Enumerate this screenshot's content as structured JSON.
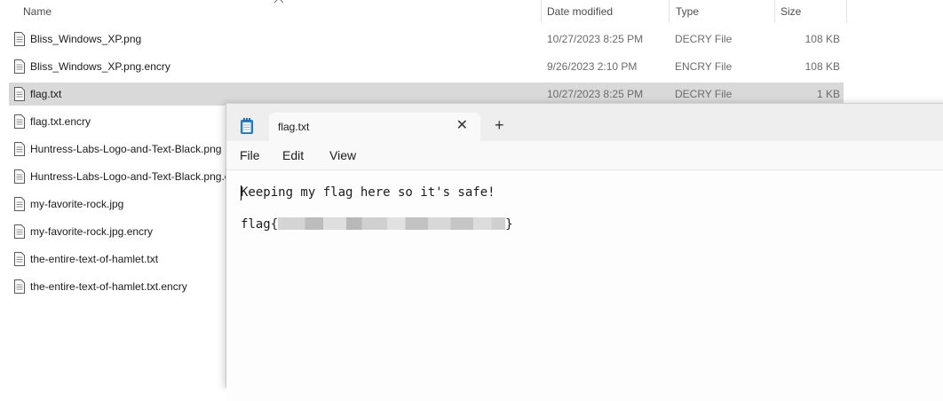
{
  "explorer": {
    "columns": {
      "name": "Name",
      "date": "Date modified",
      "type": "Type",
      "size": "Size"
    },
    "files": [
      {
        "name": "Bliss_Windows_XP.png",
        "date": "10/27/2023 8:25 PM",
        "type": "DECRY File",
        "size": "108 KB",
        "selected": false
      },
      {
        "name": "Bliss_Windows_XP.png.encry",
        "date": "9/26/2023 2:10 PM",
        "type": "ENCRY File",
        "size": "108 KB",
        "selected": false
      },
      {
        "name": "flag.txt",
        "date": "10/27/2023 8:25 PM",
        "type": "DECRY File",
        "size": "1 KB",
        "selected": true
      },
      {
        "name": "flag.txt.encry",
        "date": "",
        "type": "",
        "size": "",
        "selected": false
      },
      {
        "name": "Huntress-Labs-Logo-and-Text-Black.png",
        "date": "",
        "type": "",
        "size": "",
        "selected": false
      },
      {
        "name": "Huntress-Labs-Logo-and-Text-Black.png.e",
        "date": "",
        "type": "",
        "size": "",
        "selected": false
      },
      {
        "name": "my-favorite-rock.jpg",
        "date": "",
        "type": "",
        "size": "",
        "selected": false
      },
      {
        "name": "my-favorite-rock.jpg.encry",
        "date": "",
        "type": "",
        "size": "",
        "selected": false
      },
      {
        "name": "the-entire-text-of-hamlet.txt",
        "date": "",
        "type": "",
        "size": "",
        "selected": false
      },
      {
        "name": "the-entire-text-of-hamlet.txt.encry",
        "date": "",
        "type": "",
        "size": "",
        "selected": false
      }
    ]
  },
  "notepad": {
    "tab_title": "flag.txt",
    "tab_close_glyph": "✕",
    "new_tab_glyph": "+",
    "menu": {
      "file": "File",
      "edit": "Edit",
      "view": "View"
    },
    "content": {
      "line1": "Keeping my flag here so it's safe!",
      "flag_prefix": "flag{",
      "flag_suffix": "}"
    }
  },
  "icons": {
    "file": "document-icon",
    "notepad": "notepad-app-icon",
    "sort": "sort-up-icon"
  }
}
